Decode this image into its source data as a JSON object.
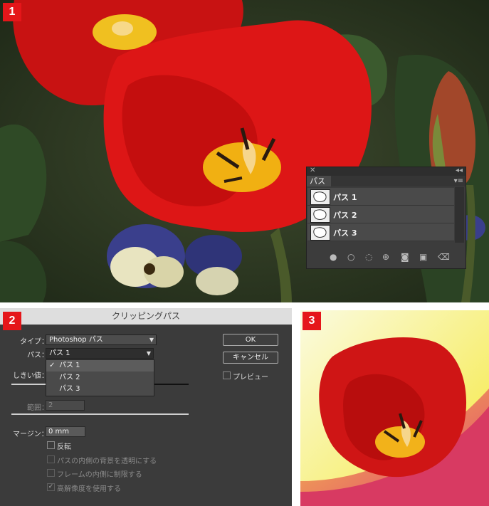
{
  "badges": [
    "1",
    "2",
    "3"
  ],
  "paths_panel": {
    "close_glyph": "✕",
    "collapse_glyph": "◂◂",
    "tab_label": "パス",
    "menu_glyph": "▾≡",
    "rows": [
      {
        "label": "パス 1"
      },
      {
        "label": "パス 2"
      },
      {
        "label": "パス 3"
      }
    ],
    "footer_icons": [
      "fill-path-icon",
      "stroke-path-icon",
      "load-selection-icon",
      "make-work-path-icon",
      "add-mask-icon",
      "new-path-icon",
      "trash-icon"
    ]
  },
  "dialog": {
    "title": "クリッピングパス",
    "type_label": "タイプ：",
    "type_value": "Photoshop パス",
    "path_label": "パス：",
    "path_value": "パス 1",
    "threshold_label": "しきい値：",
    "range_label": "範囲：",
    "range_value": "2",
    "margin_label": "マージン：",
    "margin_value": "0 mm",
    "ok_label": "OK",
    "cancel_label": "キャンセル",
    "preview_label": "プレビュー",
    "options": [
      {
        "label": "反転",
        "checked": false,
        "enabled": true
      },
      {
        "label": "パスの内側の背景を透明にする",
        "checked": false,
        "enabled": false
      },
      {
        "label": "フレームの内側に制限する",
        "checked": false,
        "enabled": false
      },
      {
        "label": "高解像度を使用する",
        "checked": true,
        "enabled": false
      }
    ],
    "dropdown_items": [
      {
        "label": "パス 1",
        "check": "✓"
      },
      {
        "label": "パス 2",
        "check": ""
      },
      {
        "label": "パス 3",
        "check": ""
      }
    ]
  },
  "colors": {
    "badge": "#e5161a",
    "tulip_red": "#d41414",
    "dialog_bg": "#3b3b3b"
  }
}
